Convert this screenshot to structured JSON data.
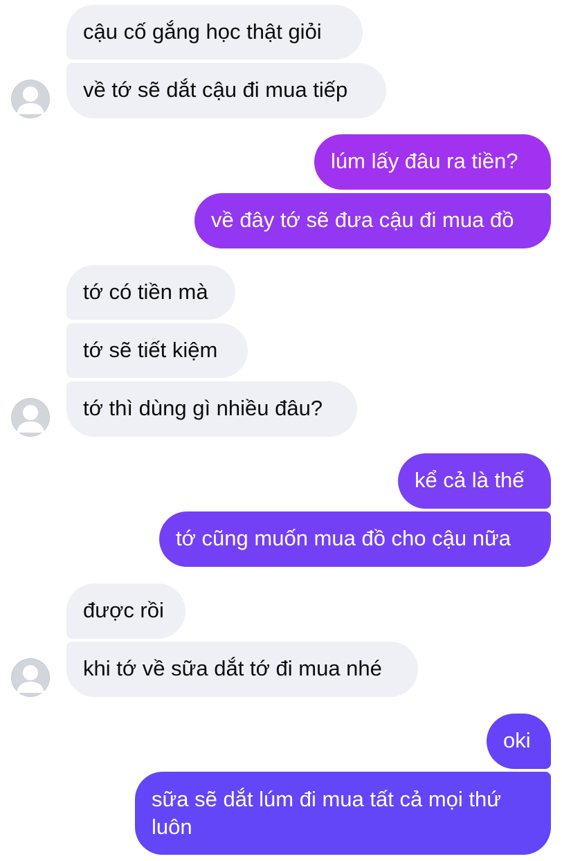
{
  "chat": {
    "messages": [
      {
        "sender": "them",
        "text": "cậu cố gắng học thật giỏi"
      },
      {
        "sender": "them",
        "text": "về tớ sẽ dắt cậu đi mua tiếp"
      },
      {
        "sender": "me",
        "text": "lúm lấy đâu ra tiền?"
      },
      {
        "sender": "me",
        "text": "về đây tớ sẽ đưa cậu đi mua đồ"
      },
      {
        "sender": "them",
        "text": "tớ có tiền mà"
      },
      {
        "sender": "them",
        "text": "tớ sẽ tiết kiệm"
      },
      {
        "sender": "them",
        "text": "tớ thì dùng gì nhiều đâu?"
      },
      {
        "sender": "me",
        "text": "kể cả là thế"
      },
      {
        "sender": "me",
        "text": "tớ cũng muốn mua đồ cho cậu nữa"
      },
      {
        "sender": "them",
        "text": "được rồi"
      },
      {
        "sender": "them",
        "text": "khi tớ về sữa dắt tớ đi mua nhé"
      },
      {
        "sender": "me",
        "text": "oki"
      },
      {
        "sender": "me",
        "text": "sữa sẽ dắt lúm đi mua tất cả mọi thứ luôn"
      }
    ]
  },
  "colors": {
    "incoming_bubble": "#eef0f5",
    "outgoing_gradient_top": "#a132ef",
    "outgoing_gradient_bottom": "#6346f8",
    "avatar_bg": "#d2d6dc"
  },
  "icons": {
    "avatar": "default-user-avatar-icon"
  }
}
